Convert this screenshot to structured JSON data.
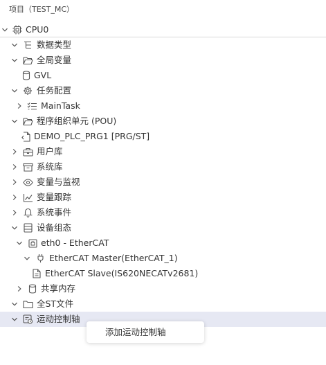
{
  "panel": {
    "title": "项目（TEST_MC）"
  },
  "tree": {
    "root": {
      "label": "CPU0",
      "icon": "cpu-icon"
    },
    "items": [
      {
        "label": "数据类型",
        "icon": "data-type-icon"
      },
      {
        "label": "全局变量",
        "icon": "folder-open-icon"
      },
      {
        "label": "GVL",
        "icon": "database-icon"
      },
      {
        "label": "任务配置",
        "icon": "gear-icon"
      },
      {
        "label": "MainTask",
        "icon": "task-list-icon"
      },
      {
        "label": "程序组织单元 (POU)",
        "icon": "folder-open-icon"
      },
      {
        "label": "DEMO_PLC_PRG1 [PRG/ST]",
        "icon": "program-file-icon"
      },
      {
        "label": "用户库",
        "icon": "briefcase-icon"
      },
      {
        "label": "系统库",
        "icon": "archive-icon"
      },
      {
        "label": "变量与监视",
        "icon": "eye-icon"
      },
      {
        "label": "变量跟踪",
        "icon": "trend-chart-icon"
      },
      {
        "label": "系统事件",
        "icon": "bell-icon"
      },
      {
        "label": "设备组态",
        "icon": "device-stack-icon"
      },
      {
        "label": "eth0 - EtherCAT",
        "icon": "network-port-icon"
      },
      {
        "label": "EtherCAT Master(EtherCAT_1)",
        "icon": "plug-icon"
      },
      {
        "label": "EtherCAT Slave(IS620NECATv2681)",
        "icon": "slave-file-icon"
      },
      {
        "label": "共享内存",
        "icon": "database-icon"
      },
      {
        "label": "全ST文件",
        "icon": "folder-icon"
      },
      {
        "label": "运动控制轴",
        "icon": "motion-axis-icon"
      }
    ]
  },
  "context_menu": {
    "items": [
      {
        "label": "添加运动控制轴"
      }
    ]
  },
  "colors": {
    "selected_row": "#e6e8f3",
    "text": "#333333"
  }
}
